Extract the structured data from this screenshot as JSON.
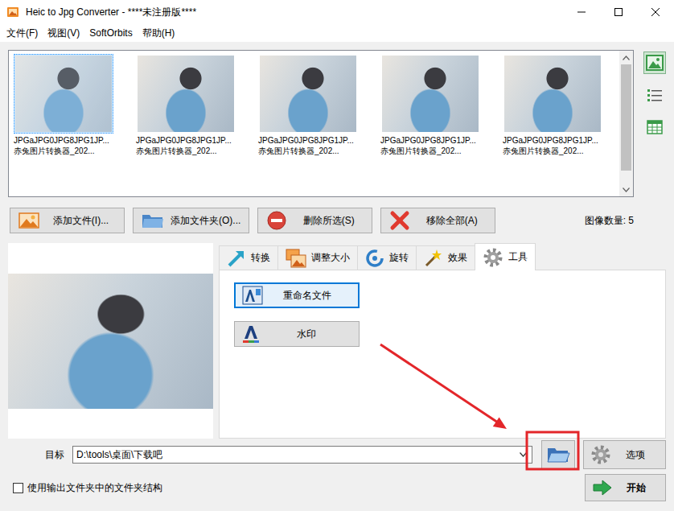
{
  "window": {
    "title": "Heic to Jpg Converter - ****未注册版****"
  },
  "menu": [
    "文件(F)",
    "视图(V)",
    "SoftOrbits",
    "帮助(H)"
  ],
  "thumbnails": [
    {
      "line1": "JPGaJPG0JPG8JPG1JP...",
      "line2": "赤兔图片转换器_202...",
      "selected": true
    },
    {
      "line1": "JPGaJPG0JPG8JPG1JP...",
      "line2": "赤兔图片转换器_202...",
      "selected": false
    },
    {
      "line1": "JPGaJPG0JPG8JPG1JP...",
      "line2": "赤兔图片转换器_202...",
      "selected": false
    },
    {
      "line1": "JPGaJPG0JPG8JPG1JP...",
      "line2": "赤兔图片转换器_202...",
      "selected": false
    },
    {
      "line1": "JPGaJPG0JPG8JPG1JP...",
      "line2": "赤兔图片转换器_202...",
      "selected": false
    }
  ],
  "thumbnail_scroll": {
    "level": 0.9
  },
  "view_modes": [
    {
      "kind": "thumbnails",
      "selected": true
    },
    {
      "kind": "list",
      "selected": false
    },
    {
      "kind": "grid",
      "selected": false
    }
  ],
  "file_buttons": [
    {
      "label": "添加文件(I)...",
      "kind": "add-file"
    },
    {
      "label": "添加文件夹(O)...",
      "kind": "add-folder"
    },
    {
      "label": "删除所选(S)",
      "kind": "delete"
    },
    {
      "label": "移除全部(A)",
      "kind": "remove-all"
    }
  ],
  "image_count": "图像数量: 5",
  "tabs": [
    {
      "label": "转换",
      "kind": "convert",
      "selected": false
    },
    {
      "label": "调整大小",
      "kind": "resize",
      "selected": false
    },
    {
      "label": "旋转",
      "kind": "rotate",
      "selected": false
    },
    {
      "label": "效果",
      "kind": "effects",
      "selected": false
    },
    {
      "label": "工具",
      "kind": "tools",
      "selected": true
    }
  ],
  "tools": [
    {
      "label": "重命名文件",
      "kind": "rename",
      "selected": true
    },
    {
      "label": "水印",
      "kind": "watermark",
      "selected": false
    }
  ],
  "target": {
    "label": "目标",
    "value": "D:\\tools\\桌面\\下载吧"
  },
  "options_button": "选项",
  "folder_structure": {
    "label": "使用输出文件夹中的文件夹结构",
    "checked": false
  },
  "start_button": "开始"
}
